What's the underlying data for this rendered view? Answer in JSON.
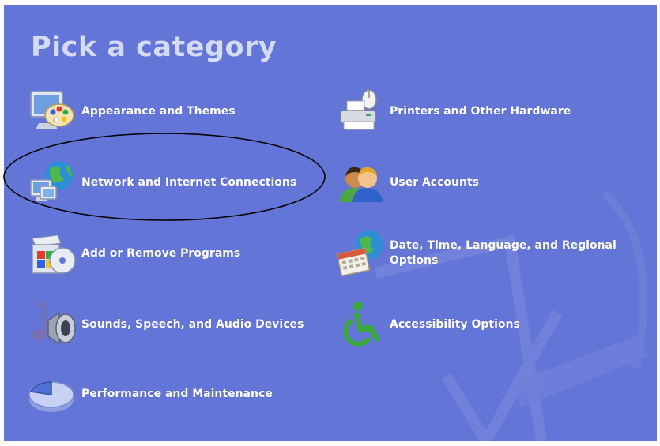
{
  "heading": "Pick a category",
  "colors": {
    "panel_background": "#6375d6",
    "heading_text": "#d3dbf5",
    "link_text": "#ffffff",
    "annotation_ellipse": "#000000"
  },
  "categories": [
    {
      "label": "Appearance and Themes",
      "icon": "appearance-themes-icon"
    },
    {
      "label": "Printers and Other Hardware",
      "icon": "printer-mouse-icon"
    },
    {
      "label": "Network and Internet Connections",
      "icon": "network-globe-icon"
    },
    {
      "label": "User Accounts",
      "icon": "user-accounts-icon"
    },
    {
      "label": "Add or Remove Programs",
      "icon": "add-remove-programs-icon"
    },
    {
      "label": "Date, Time, Language, and Regional Options",
      "icon": "calendar-globe-icon"
    },
    {
      "label": "Sounds, Speech, and Audio Devices",
      "icon": "speaker-music-icon"
    },
    {
      "label": "Accessibility Options",
      "icon": "accessibility-icon"
    },
    {
      "label": "Performance and Maintenance",
      "icon": "pie-chart-icon"
    }
  ]
}
